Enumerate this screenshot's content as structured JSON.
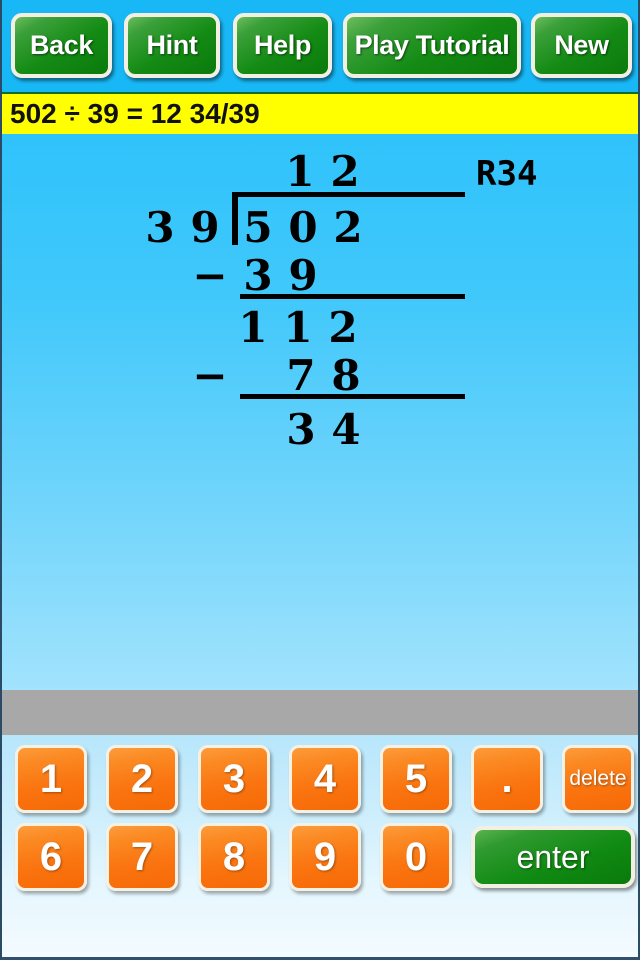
{
  "toolbar": {
    "buttons": [
      {
        "id": "back",
        "label": "Back"
      },
      {
        "id": "hint",
        "label": "Hint"
      },
      {
        "id": "help",
        "label": "Help"
      },
      {
        "id": "tutorial",
        "label": "Play Tutorial"
      },
      {
        "id": "new",
        "label": "New"
      }
    ]
  },
  "status": {
    "text": "502 ÷ 39 = 12 34/39",
    "background_color": "#ffff00"
  },
  "problem": {
    "dividend": "502",
    "divisor": "39",
    "quotient": "12",
    "remainder": "34",
    "remainder_label": "R34",
    "quotient_digits": [
      "1",
      "2"
    ],
    "divisor_digits": [
      "3",
      "9"
    ],
    "dividend_digits": [
      "5",
      "0",
      "2"
    ],
    "step1_subtrahend": [
      "3",
      "9"
    ],
    "step1_difference": [
      "1",
      "1",
      "2"
    ],
    "step2_subtrahend": [
      "7",
      "8"
    ],
    "step2_difference": [
      "3",
      "4"
    ],
    "minus_sign": "−"
  },
  "keypad": {
    "row1": [
      {
        "id": "1",
        "label": "1",
        "type": "digit"
      },
      {
        "id": "2",
        "label": "2",
        "type": "digit"
      },
      {
        "id": "3",
        "label": "3",
        "type": "digit"
      },
      {
        "id": "4",
        "label": "4",
        "type": "digit"
      },
      {
        "id": "5",
        "label": "5",
        "type": "digit"
      },
      {
        "id": "dot",
        "label": ".",
        "type": "digit"
      },
      {
        "id": "delete",
        "label": "delete",
        "type": "action"
      }
    ],
    "row2": [
      {
        "id": "6",
        "label": "6",
        "type": "digit"
      },
      {
        "id": "7",
        "label": "7",
        "type": "digit"
      },
      {
        "id": "8",
        "label": "8",
        "type": "digit"
      },
      {
        "id": "9",
        "label": "9",
        "type": "digit"
      },
      {
        "id": "0",
        "label": "0",
        "type": "digit"
      },
      {
        "id": "enter",
        "label": "enter",
        "type": "action"
      }
    ]
  },
  "colors": {
    "toolbar_blue": "#18b7f5",
    "button_green": "#118a13",
    "key_orange": "#fa7410",
    "status_yellow": "#ffff00",
    "gray_bar": "#a8a8a8",
    "work_top": "#2fc3fb",
    "work_bottom": "#a2e3fd"
  }
}
